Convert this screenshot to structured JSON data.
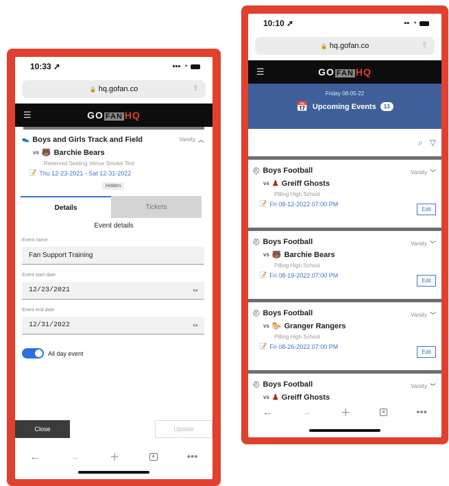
{
  "left": {
    "status": {
      "time": "10:33 ➚"
    },
    "url": "hq.gofan.co",
    "brand": {
      "go": "GO",
      "fan": "FAN",
      "hq": "HQ"
    },
    "event": {
      "sport": "Boys and Girls Track and Field",
      "level": "Varsity",
      "vs": "vs",
      "opponent": "Barchie Bears",
      "venue": "Reserved Seating Venue Smoke Test",
      "dates": "Thu 12-23-2021 - Sat 12-31-2022",
      "tag": "Hidden"
    },
    "tabs": {
      "details": "Details",
      "tickets": "Tickets"
    },
    "section_title": "Event details",
    "form": {
      "name_label": "Event name",
      "name_value": "Fan Support Training",
      "start_label": "Event start date",
      "start_value": "12/23/2021",
      "end_label": "Event end date",
      "end_value": "12/31/2022",
      "all_day_label": "All day event",
      "all_day": true
    },
    "buttons": {
      "close": "Close",
      "update": "Update"
    },
    "nav": {
      "tabs_count": "4"
    }
  },
  "right": {
    "status": {
      "time": "10:10 ➚"
    },
    "url": "hq.gofan.co",
    "brand": {
      "go": "GO",
      "fan": "FAN",
      "hq": "HQ"
    },
    "banner": {
      "date": "Friday 08-05-22",
      "title": "Upcoming Events",
      "count": "13"
    },
    "events": [
      {
        "sport": "Boys Football",
        "level": "Varsity",
        "opponent": "Greiff Ghosts",
        "venue": "Pilling High School",
        "date": "Fri 08-12-2022 07:00 PM",
        "edit": "Edit"
      },
      {
        "sport": "Boys Football",
        "level": "Varsity",
        "opponent": "Barchie Bears",
        "venue": "Pilling High School",
        "date": "Fri 08-19-2022 07:00 PM",
        "edit": "Edit"
      },
      {
        "sport": "Boys Football",
        "level": "Varsity",
        "opponent": "Granger Rangers",
        "venue": "Pilling High School",
        "date": "Fri 08-26-2022 07:00 PM",
        "edit": "Edit"
      },
      {
        "sport": "Boys Football",
        "level": "Varsity",
        "opponent": "Greiff Ghosts"
      }
    ],
    "vs": "vs",
    "nav": {
      "tabs_count": "4"
    }
  }
}
